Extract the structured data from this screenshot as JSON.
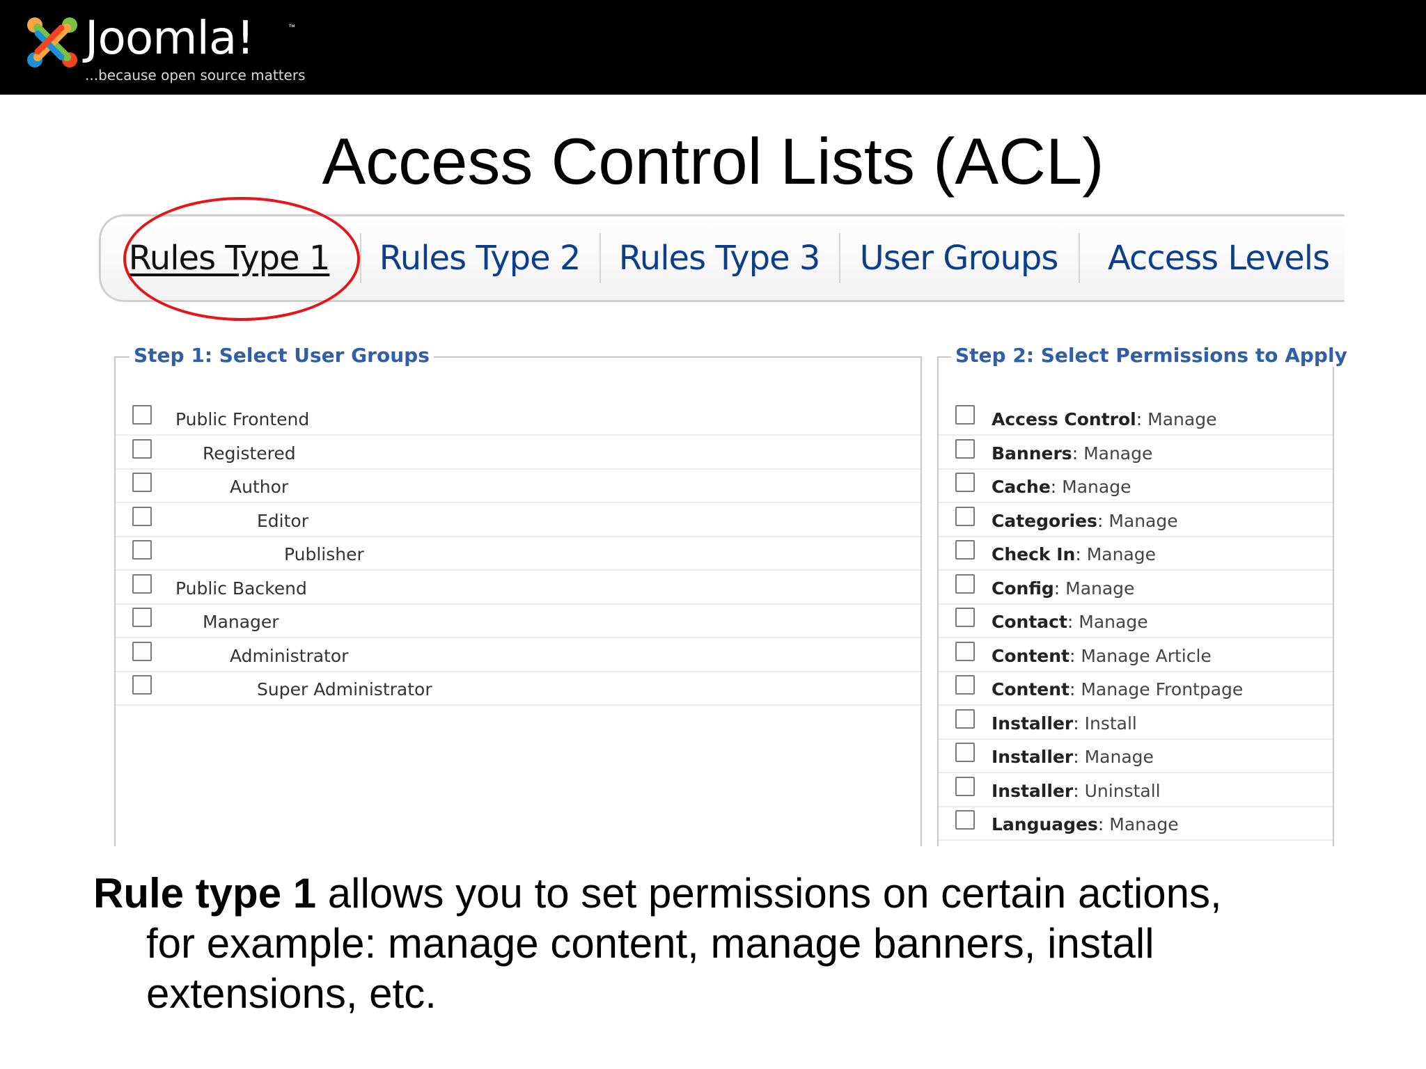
{
  "header": {
    "brand": "Joomla!",
    "trademark": "™",
    "tagline": "...because open source matters"
  },
  "slide": {
    "title": "Access Control Lists (ACL)"
  },
  "tabs": [
    {
      "label": "Rules Type 1",
      "active": true
    },
    {
      "label": "Rules Type 2",
      "active": false
    },
    {
      "label": "Rules Type 3",
      "active": false
    },
    {
      "label": "User Groups",
      "active": false
    },
    {
      "label": "Access Levels",
      "active": false
    }
  ],
  "step1": {
    "legend": "Step 1: Select User Groups",
    "groups": [
      {
        "label": "Public Frontend",
        "level": 0,
        "checked": false
      },
      {
        "label": "Registered",
        "level": 1,
        "checked": false
      },
      {
        "label": "Author",
        "level": 2,
        "checked": false
      },
      {
        "label": "Editor",
        "level": 3,
        "checked": false
      },
      {
        "label": "Publisher",
        "level": 4,
        "checked": false
      },
      {
        "label": "Public Backend",
        "level": 0,
        "checked": false
      },
      {
        "label": "Manager",
        "level": 1,
        "checked": false
      },
      {
        "label": "Administrator",
        "level": 2,
        "checked": false
      },
      {
        "label": "Super Administrator",
        "level": 3,
        "checked": false
      }
    ]
  },
  "step2": {
    "legend": "Step 2: Select Permissions to Apply",
    "permissions": [
      {
        "name": "Access Control",
        "sep": ": ",
        "action": "Manage",
        "checked": false
      },
      {
        "name": "Banners",
        "sep": ": ",
        "action": "Manage",
        "checked": false
      },
      {
        "name": "Cache",
        "sep": ": ",
        "action": "Manage",
        "checked": false
      },
      {
        "name": "Categories",
        "sep": ": ",
        "action": "Manage",
        "checked": false
      },
      {
        "name": "Check In",
        "sep": ": ",
        "action": "Manage",
        "checked": false
      },
      {
        "name": "Config",
        "sep": ": ",
        "action": "Manage",
        "checked": false
      },
      {
        "name": "Contact",
        "sep": ": ",
        "action": "Manage",
        "checked": false
      },
      {
        "name": "Content",
        "sep": ": ",
        "action": "Manage Article",
        "checked": false
      },
      {
        "name": "Content",
        "sep": ": ",
        "action": "Manage Frontpage",
        "checked": false
      },
      {
        "name": "Installer",
        "sep": ": ",
        "action": "Install",
        "checked": false
      },
      {
        "name": "Installer",
        "sep": ": ",
        "action": "Manage",
        "checked": false
      },
      {
        "name": "Installer",
        "sep": ": ",
        "action": "Uninstall",
        "checked": false
      },
      {
        "name": "Languages",
        "sep": ": ",
        "action": "Manage",
        "checked": false
      }
    ]
  },
  "description": {
    "bold": "Rule type 1",
    "line1_rest": " allows you to set permissions on certain actions,",
    "line2": "for example: manage content, manage banners, install",
    "line3": "extensions, etc."
  },
  "colors": {
    "header_bg": "#000000",
    "tab_link": "#0b3f8c",
    "legend": "#2f5fa8",
    "highlight_oval": "#e8141b"
  }
}
